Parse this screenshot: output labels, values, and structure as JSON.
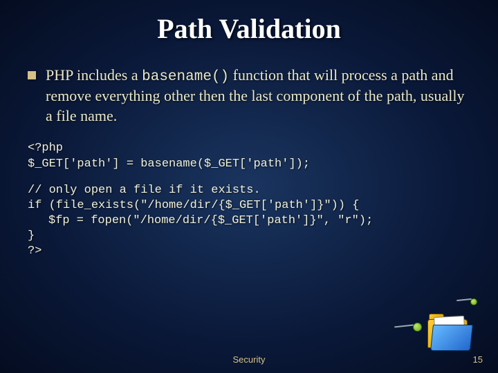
{
  "title": "Path Validation",
  "bullet_text_pre": "PHP includes a ",
  "bullet_code": "basename()",
  "bullet_text_post": " function that will process a path and remove everything other then the last component of the path, usually a file name.",
  "code_block_1_line1": "<?php",
  "code_block_1_line2": "$_GET['path'] = basename($_GET['path']);",
  "code_block_2_line1": "// only open a file if it exists.",
  "code_block_2_line2": "if (file_exists(\"/home/dir/{$_GET['path']}\")) {",
  "code_block_2_line3": "$fp = fopen(\"/home/dir/{$_GET['path']}\", \"r\");",
  "code_block_2_line4": "}",
  "code_block_2_line5": "?>",
  "footer": "Security",
  "page": "15"
}
